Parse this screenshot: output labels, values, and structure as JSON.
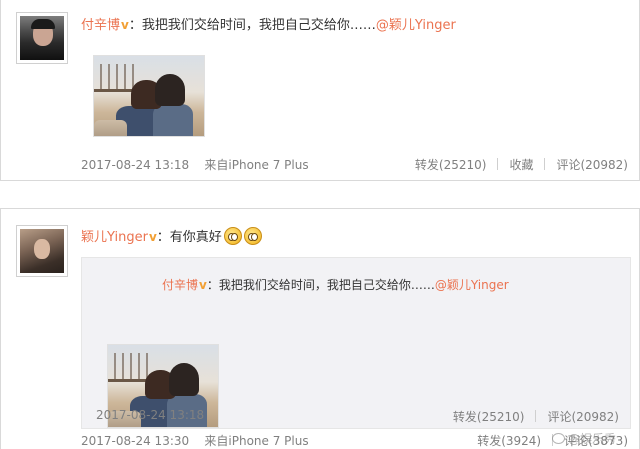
{
  "posts": [
    {
      "author": "付辛博",
      "verified_badge": "v",
      "separator": "：",
      "text": "我把我们交给时间，我把自己交给你……",
      "mention": "@颖儿Yinger",
      "timestamp": "2017-08-24 13:18",
      "source": "来自iPhone 7 Plus",
      "actions": {
        "repost": "转发(25210)",
        "favorite": "收藏",
        "comment": "评论(20982)"
      }
    },
    {
      "author": "颖儿Yinger",
      "verified_badge": "v",
      "separator": "：",
      "text": "有你真好",
      "emoji": [
        "emoji-smile-face",
        "emoji-smile-face"
      ],
      "repost": {
        "author": "付辛博",
        "verified_badge": "v",
        "separator": "：",
        "text": "我把我们交给时间，我把自己交给你……",
        "mention": "@颖儿Yinger",
        "timestamp": "2017-08-24 13:18",
        "actions": {
          "repost": "转发(25210)",
          "comment": "评论(20982)"
        }
      },
      "timestamp": "2017-08-24 13:30",
      "source": "来自iPhone 7 Plus",
      "actions": {
        "repost": "转发(3924)",
        "comment": "评论(3873)"
      }
    }
  ],
  "watermark": "@娱乐秀"
}
